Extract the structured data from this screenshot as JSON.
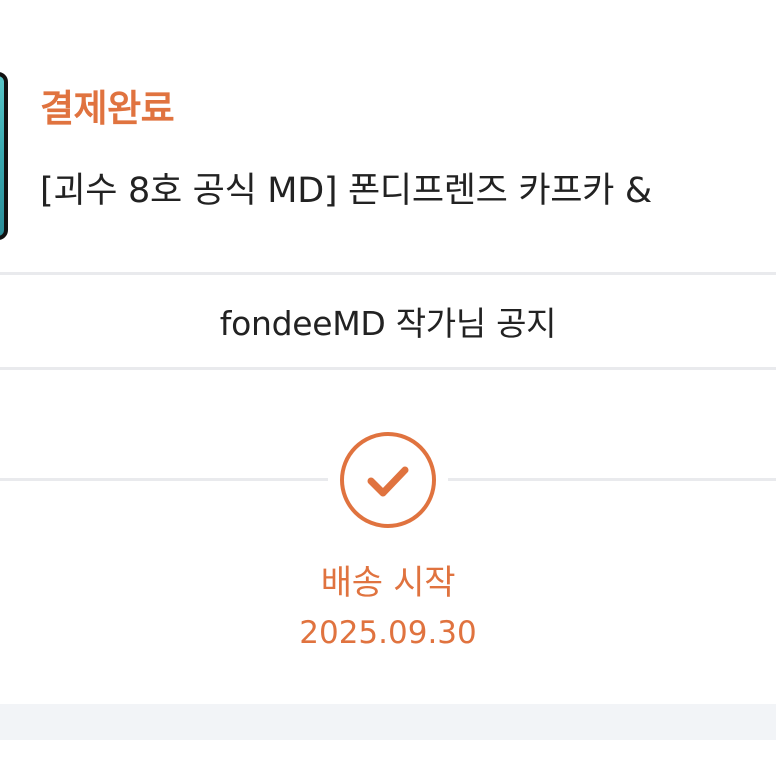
{
  "order": {
    "status": "결제완료",
    "product_title": "[괴수 8호 공식 MD] 폰디프렌즈 카프카 & "
  },
  "notice": {
    "label": "fondeeMD 작가님 공지"
  },
  "tracking": {
    "step_label": "배송 시작",
    "step_date": "2025.09.30"
  },
  "colors": {
    "accent": "#e0733f",
    "divider": "#e9eaed",
    "band": "#f2f4f7"
  },
  "icons": {
    "step": "check-circle-icon"
  }
}
